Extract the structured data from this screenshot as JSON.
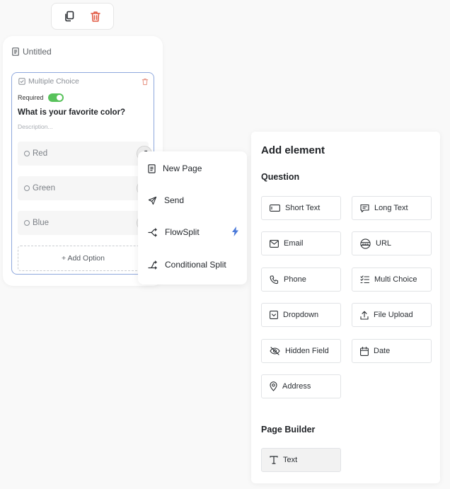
{
  "toolbar": {
    "copy_icon": "copy-icon",
    "delete_icon": "trash-icon",
    "delete_color": "#e25b45"
  },
  "page": {
    "title": "Untitled"
  },
  "question": {
    "type_label": "Multiple Choice",
    "required_label": "Required",
    "required_on": true,
    "text": "What is your favorite color?",
    "description_placeholder": "Description...",
    "options": [
      "Red",
      "Green",
      "Blue"
    ],
    "add_option_label": "+ Add Option"
  },
  "menu": {
    "items": [
      {
        "label": "New Page",
        "icon": "page-icon"
      },
      {
        "label": "Send",
        "icon": "send-icon"
      },
      {
        "label": "FlowSplit",
        "icon": "split-icon"
      },
      {
        "label": "Conditional Split",
        "icon": "conditional-split-icon"
      }
    ],
    "bolt_icon": "lightning-icon"
  },
  "panel": {
    "title": "Add element",
    "question_section": "Question",
    "question_elements": [
      {
        "label": "Short Text",
        "icon": "short-text-icon"
      },
      {
        "label": "Long Text",
        "icon": "long-text-icon"
      },
      {
        "label": "Email",
        "icon": "email-icon"
      },
      {
        "label": "URL",
        "icon": "url-icon"
      },
      {
        "label": "Phone",
        "icon": "phone-icon"
      },
      {
        "label": "Multi Choice",
        "icon": "checklist-icon"
      },
      {
        "label": "Dropdown",
        "icon": "dropdown-icon"
      },
      {
        "label": "File Upload",
        "icon": "upload-icon"
      },
      {
        "label": "Hidden Field",
        "icon": "eye-off-icon"
      },
      {
        "label": "Date",
        "icon": "calendar-icon"
      },
      {
        "label": "Address",
        "icon": "location-icon"
      }
    ],
    "builder_section": "Page Builder",
    "builder_elements": [
      {
        "label": "Text",
        "icon": "text-icon"
      }
    ]
  },
  "colors": {
    "accent_green": "#58c25b",
    "selection_border": "#8fa8dd",
    "flowsplit_bolt": "#4a79d9"
  }
}
